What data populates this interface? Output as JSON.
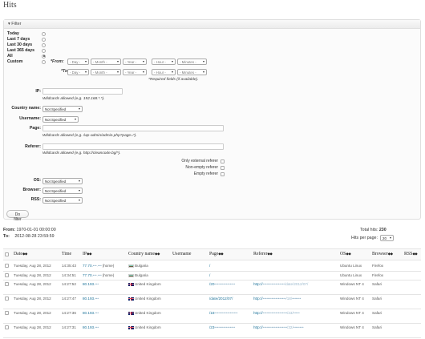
{
  "page": {
    "title": "Hits"
  },
  "filter": {
    "header": "▾ Filter",
    "periods": [
      {
        "label": "Today",
        "checked": false
      },
      {
        "label": "Last 7 days",
        "checked": false
      },
      {
        "label": "Last 30 days",
        "checked": false
      },
      {
        "label": "Last 365 days",
        "checked": false
      },
      {
        "label": "All",
        "checked": true
      },
      {
        "label": "Custom",
        "checked": false
      }
    ],
    "custom": {
      "from_label": "*From:",
      "to_label": "*To:",
      "day": "- Day -",
      "month": "- Month -",
      "year": "- Year -",
      "hour": "- Hour -",
      "minutes": "- Minutes -",
      "required_note": "*Required fields (if available)."
    },
    "ip": {
      "label": "IP:",
      "value": "",
      "help": "Wildcards allowed (e.g. 192.168.*.*)."
    },
    "country": {
      "label": "Country name:",
      "value": "Not Specified"
    },
    "username": {
      "label": "Username:",
      "value": "Not Specified"
    },
    "page": {
      "label": "Page:",
      "value": "",
      "help": "Wildcards allowed (e.g. /wp-admin/admin.php?page=*)."
    },
    "referer": {
      "label": "Referer:",
      "value": "",
      "help": "Wildcards allowed (e.g. http://cleancode.bg/*).",
      "options": [
        {
          "label": "Only external referer",
          "checked": false
        },
        {
          "label": "Non-empty referer",
          "checked": false
        },
        {
          "label": "Empty referer",
          "checked": false
        }
      ]
    },
    "os": {
      "label": "OS:",
      "value": "Not Specified"
    },
    "browser": {
      "label": "Browser:",
      "value": "Not Specified"
    },
    "rss": {
      "label": "RSS:",
      "value": "Not Specified"
    },
    "submit": "Do filter"
  },
  "summary": {
    "from_label": "From:",
    "from_value": "1970-01-01 00:00:00",
    "to_label": "To:",
    "to_value": "2012-08-28 23:59:59",
    "total_label": "Total hits:",
    "total_value": "230",
    "perpage_label": "Hits per page:",
    "perpage_value": "20"
  },
  "table": {
    "columns": [
      "Date",
      "Time",
      "IP",
      "Country name",
      "Username",
      "Page",
      "Referer",
      "OS",
      "Browser",
      "RSS"
    ],
    "sort_arrows": "◆◆",
    "rows": [
      {
        "date": "Tuesday, Aug 28, 2012",
        "time": "14:35:43",
        "ip": "77.70.",
        "ip_blur": "•••.•••",
        "ip_suffix": "(home)",
        "flag": "bg",
        "country": "Bulgaria",
        "page": "/",
        "page_blur": "",
        "referer": "",
        "referer_blur": "",
        "os": "Ubuntu Linux",
        "browser": "Firefox"
      },
      {
        "date": "Tuesday, Aug 28, 2012",
        "time": "14:34:51",
        "ip": "77.70.",
        "ip_blur": "•••.•••",
        "ip_suffix": "(home)",
        "flag": "bg",
        "country": "Bulgaria",
        "page": "/",
        "page_blur": "",
        "referer": "",
        "referer_blur": "",
        "os": "Ubuntu Linux",
        "browser": "Firefox"
      },
      {
        "date": "Tuesday, Aug 28, 2012",
        "time": "14:27:52",
        "ip": "80.193.",
        "ip_blur": "•••",
        "ip_suffix": "",
        "flag": "gb",
        "country": "United Kingdom",
        "page": "/20",
        "page_blur": "••••••••••••••••",
        "referer": "http://",
        "referer_blur": "•••••••••••••••••/date/2012/07/",
        "os": "Windows NT 4",
        "browser": "Safari"
      },
      {
        "date": "Tuesday, Aug 28, 2012",
        "time": "14:27:47",
        "ip": "80.193.",
        "ip_blur": "•••",
        "ip_suffix": "",
        "flag": "gb",
        "country": "United Kingdom",
        "page": "/date/2012/07/",
        "page_blur": "",
        "referer": "http://",
        "referer_blur": "••••••••••••••••••/18/•••••••",
        "os": "Windows NT 4",
        "browser": "Safari"
      },
      {
        "date": "Tuesday, Aug 28, 2012",
        "time": "14:27:36",
        "ip": "80.193.",
        "ip_blur": "•••",
        "ip_suffix": "",
        "flag": "gb",
        "country": "United Kingdom",
        "page": "/18",
        "page_blur": "••••••••••••••••••",
        "referer": "http://",
        "referer_blur": "•••••••••••••••••••/23/•••••",
        "os": "Windows NT 4",
        "browser": "Safari"
      },
      {
        "date": "Tuesday, Aug 28, 2012",
        "time": "14:27:31",
        "ip": "80.193.",
        "ip_blur": "•••",
        "ip_suffix": "",
        "flag": "gb",
        "country": "United Kingdom",
        "page": "/23",
        "page_blur": "••••••••••••••••",
        "referer": "http://",
        "referer_blur": "•••••••••••••••••••/32/••••••••",
        "os": "Windows NT 4",
        "browser": "Safari"
      }
    ]
  }
}
